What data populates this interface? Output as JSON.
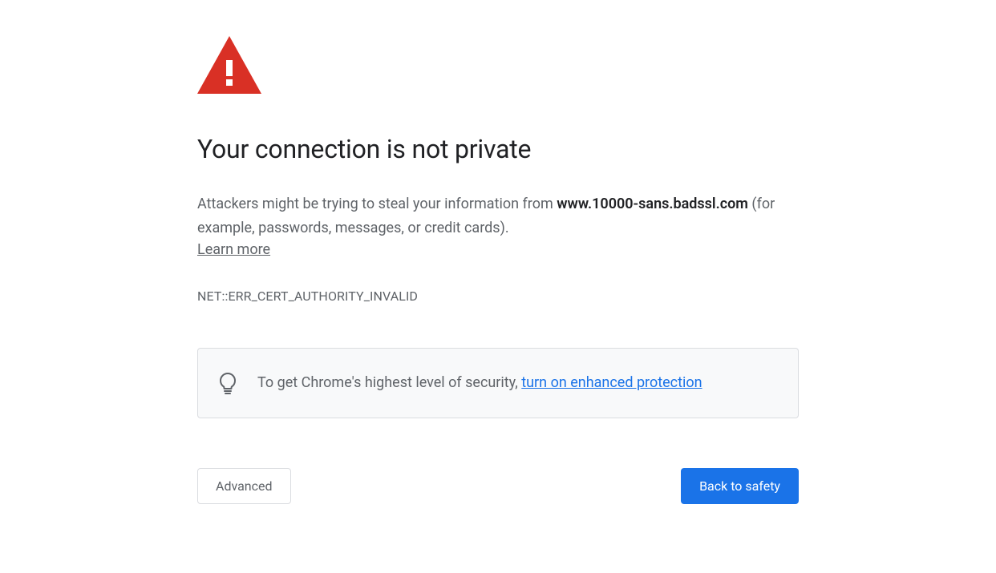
{
  "heading": "Your connection is not private",
  "description": {
    "prefix": "Attackers might be trying to steal your information from ",
    "host": "www.10000-sans.badssl.com",
    "suffix": " (for example, passwords, messages, or credit cards). "
  },
  "learn_more": "Learn more",
  "error_code": "NET::ERR_CERT_AUTHORITY_INVALID",
  "tip": {
    "prefix": "To get Chrome's highest level of security, ",
    "link": "turn on enhanced protection"
  },
  "buttons": {
    "advanced": "Advanced",
    "back_to_safety": "Back to safety"
  },
  "colors": {
    "warning_red": "#d93025",
    "primary_blue": "#1a73e8",
    "text_secondary": "#5f6368",
    "box_bg": "#f8f9fa",
    "border": "#dadce0"
  }
}
